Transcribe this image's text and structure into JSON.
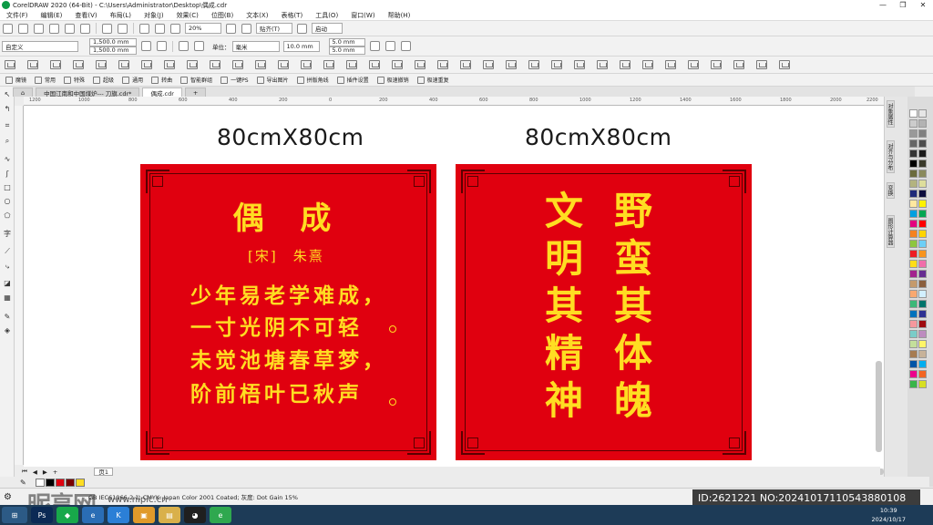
{
  "window": {
    "title": "CorelDRAW 2020 (64-Bit) - C:\\Users\\Administrator\\Desktop\\偶成.cdr",
    "controls": [
      "—",
      "❐",
      "✕"
    ]
  },
  "menu": [
    "文件(F)",
    "编辑(E)",
    "查看(V)",
    "布局(L)",
    "对象(J)",
    "效果(C)",
    "位图(B)",
    "文本(X)",
    "表格(T)",
    "工具(O)",
    "窗口(W)",
    "帮助(H)"
  ],
  "toolbar1": {
    "zoom": "20%",
    "snap": "贴齐(T)",
    "launch": "启动"
  },
  "toolbar2": {
    "preset": "自定义",
    "width": "1,500.0 mm",
    "height": "1,500.0 mm",
    "unit_label": "单位：",
    "unit": "毫米",
    "nudge": "10.0 mm",
    "dup_x": "5.0 mm",
    "dup_y": "5.0 mm"
  },
  "toolbar4": [
    "魔镜",
    "常用",
    "特殊",
    "超级",
    "通用",
    "转曲",
    "智能群组",
    "一键PS",
    "导出图片",
    "拼版角线",
    "插件设置",
    "极速撤销",
    "极速重复"
  ],
  "doc_tabs": [
    "中国江南和中国煤炉--- 刀旗.cdr*",
    "偶成.cdr"
  ],
  "ruler_ticks": [
    "1200",
    "1000",
    "800",
    "600",
    "400",
    "200",
    "0",
    "200",
    "400",
    "600",
    "800",
    "1000",
    "1200",
    "1400",
    "1600",
    "1800",
    "2000",
    "2200"
  ],
  "left_panel": {
    "size_label": "80cmX80cm",
    "title": "偶 成",
    "author": "[宋]　朱熹",
    "lines": [
      "少年易老学难成，",
      "一寸光阴不可轻",
      "未觉池塘春草梦，",
      "阶前梧叶已秋声"
    ]
  },
  "right_panel": {
    "size_label": "80cmX80cm",
    "col_right": [
      "野",
      "蛮",
      "其",
      "体",
      "魄"
    ],
    "col_left": [
      "文",
      "明",
      "其",
      "精",
      "神"
    ]
  },
  "page_tab": "页1",
  "status": "GB IEC61966-2.1; CMYK: Japan Color 2001 Coated; 灰度: Dot Gain 15%",
  "watermark": "昵享网",
  "watermark_url": "www.nipic.cn",
  "image_id": "ID:2621221 NO:20241017110543880108",
  "clock": {
    "time": "10:39",
    "date": "2024/10/17"
  },
  "dock_tabs": [
    "对象属性",
    "对齐与分布",
    "变换",
    "图形计算器"
  ],
  "colors": {
    "panel_red": "#e0000f",
    "gold_text": "#ffdd22"
  }
}
